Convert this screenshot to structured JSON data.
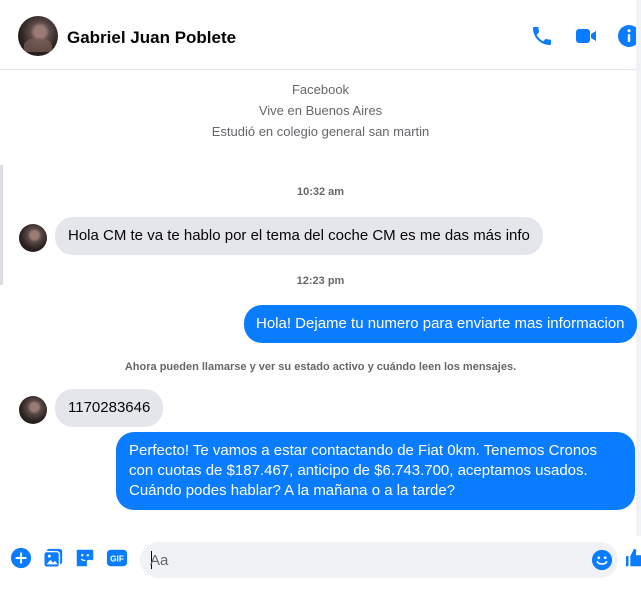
{
  "header": {
    "contact_name": "Gabriel Juan Poblete",
    "icons": [
      "phone-icon",
      "video-camera-icon",
      "info-icon"
    ]
  },
  "profile": {
    "line1": "Facebook",
    "line2": "Vive en Buenos Aires",
    "line3": "Estudió en colegio general san martin"
  },
  "conversation": {
    "time1": "10:32 am",
    "msg1": "Hola CM te va te hablo por el tema del coche CM es me das más info",
    "time2": "12:23 pm",
    "msg2": "Hola! Dejame tu numero para enviarte mas informacion",
    "notice": "Ahora pueden llamarse y ver su estado activo y cuándo leen los mensajes.",
    "msg3": "1170283646",
    "msg4": "Perfecto! Te vamos a estar contactando de Fiat 0km. Tenemos Cronos con cuotas de $187.467, anticipo de $6.743.700, aceptamos usados. Cuándo podes hablar? A la mañana o a la tarde?"
  },
  "composer": {
    "placeholder": "Aa",
    "icons": [
      "plus-circle-icon",
      "gallery-icon",
      "sticker-icon",
      "gif-icon",
      "emoji-icon",
      "thumbs-up-icon"
    ],
    "gif_label": "GIF"
  },
  "colors": {
    "accent": "#0a7cff",
    "incoming_bubble": "#e4e6eb",
    "muted_text": "#65676b"
  }
}
